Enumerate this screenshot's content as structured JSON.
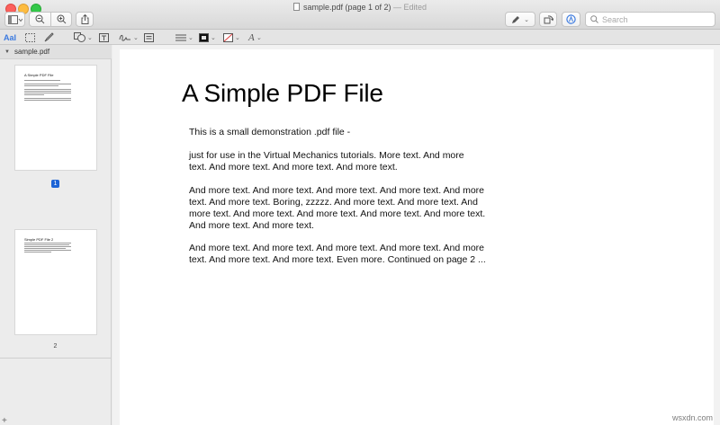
{
  "window": {
    "title": "sample.pdf (page 1 of 2)",
    "title_suffix": "— Edited"
  },
  "toolbar": {
    "search_placeholder": "Search"
  },
  "sidebar": {
    "file_name": "sample.pdf",
    "thumbnails": [
      {
        "title": "A Simple PDF File",
        "page_label": "1",
        "selected": true
      },
      {
        "title": "Simple PDF File 2",
        "page_label": "2",
        "selected": false
      }
    ],
    "footer_icon": "+"
  },
  "document": {
    "title": "A Simple PDF File",
    "paragraphs": [
      [
        "This is a small demonstration .pdf file -"
      ],
      [
        "just for use in the Virtual Mechanics tutorials. More text. And more",
        "text. And more text. And more text. And more text."
      ],
      [
        "And more text. And more text. And more text. And more text. And more",
        "text. And more text. Boring, zzzzz. And more text. And more text. And",
        "more text. And more text. And more text. And more text. And more text.",
        "And more text. And more text."
      ],
      [
        "And more text. And more text. And more text. And more text. And more",
        "text. And more text. And more text. Even more. Continued on page 2 ..."
      ]
    ]
  },
  "watermark": "wsxdn.com",
  "colors": {
    "selection_accent": "#1d64d6",
    "close": "#fc605c",
    "minimize": "#fdbc40",
    "maximize": "#34c84a",
    "markup_text_color_active": "#3b7ae0"
  },
  "icons": [
    "sidebar-toggle-icon",
    "zoom-out-icon",
    "zoom-in-icon",
    "share-icon",
    "pen-markup-icon",
    "rotate-icon",
    "annotate-circle-icon",
    "text-style-icon",
    "selection-rect-icon",
    "sketch-icon",
    "shapes-icon",
    "textbox-icon",
    "signature-icon",
    "notes-icon",
    "line-style-icon",
    "border-color-icon",
    "fill-color-icon",
    "font-icon"
  ]
}
